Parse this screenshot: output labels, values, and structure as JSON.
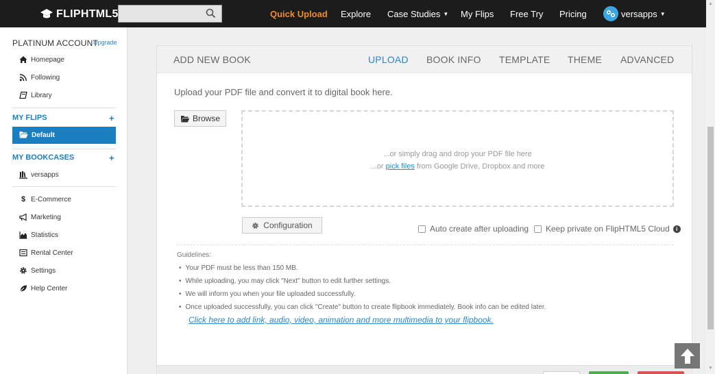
{
  "topbar": {
    "logo": "FLIPHTML5",
    "search": {
      "placeholder": "",
      "value": ""
    },
    "nav": [
      "Quick Upload",
      "Explore",
      "Case Studies",
      "My Flips",
      "Free Try",
      "Pricing"
    ],
    "username": "versapps"
  },
  "sidebar": {
    "account": "PLATINUM ACCOUNT",
    "upgrade": "Upgrade",
    "top_items": [
      "Homepage",
      "Following",
      "Library"
    ],
    "my_flips": "MY FLIPS",
    "default_item": "Default",
    "my_bookcases": "MY BOOKCASES",
    "bookcase_item": "versapps",
    "bottom_items": [
      "E-Commerce",
      "Marketing",
      "Statistics",
      "Rental Center",
      "Settings",
      "Help Center"
    ]
  },
  "panel": {
    "title": "ADD NEW BOOK",
    "tabs": [
      "UPLOAD",
      "BOOK INFO",
      "TEMPLATE",
      "THEME",
      "ADVANCED"
    ],
    "active_tab": "UPLOAD",
    "intro": "Upload your PDF file and convert it to digital book here.",
    "browse": "Browse",
    "drop_line1": "...or simply drag and drop your PDF file here",
    "drop_line2_prefix": "...or ",
    "drop_line2_link": "pick files",
    "drop_line2_suffix": " from Google Drive, Dropbox and more",
    "configuration": "Configuration",
    "auto_create": "Auto create after uploading",
    "keep_private": "Keep private on FlipHTML5 Cloud",
    "guidelines_title": "Guidelines:",
    "guidelines": [
      "Your PDF must be less than 150 MB.",
      "While uploading, you may click \"Next\" button to edit further settings.",
      "We will inform you when your file uploaded successfully.",
      "Once uploaded successfully, you can click \"Create\" button to create flipbook immediately. Book info can be edited later."
    ],
    "multimedia_link": "Click here to add link, audio, video, animation and more multimedia to your flipbook."
  },
  "colors": {
    "brand_blue": "#1a7fc1",
    "quick_upload_orange": "#f18a26",
    "link_blue": "#2a87c9"
  }
}
